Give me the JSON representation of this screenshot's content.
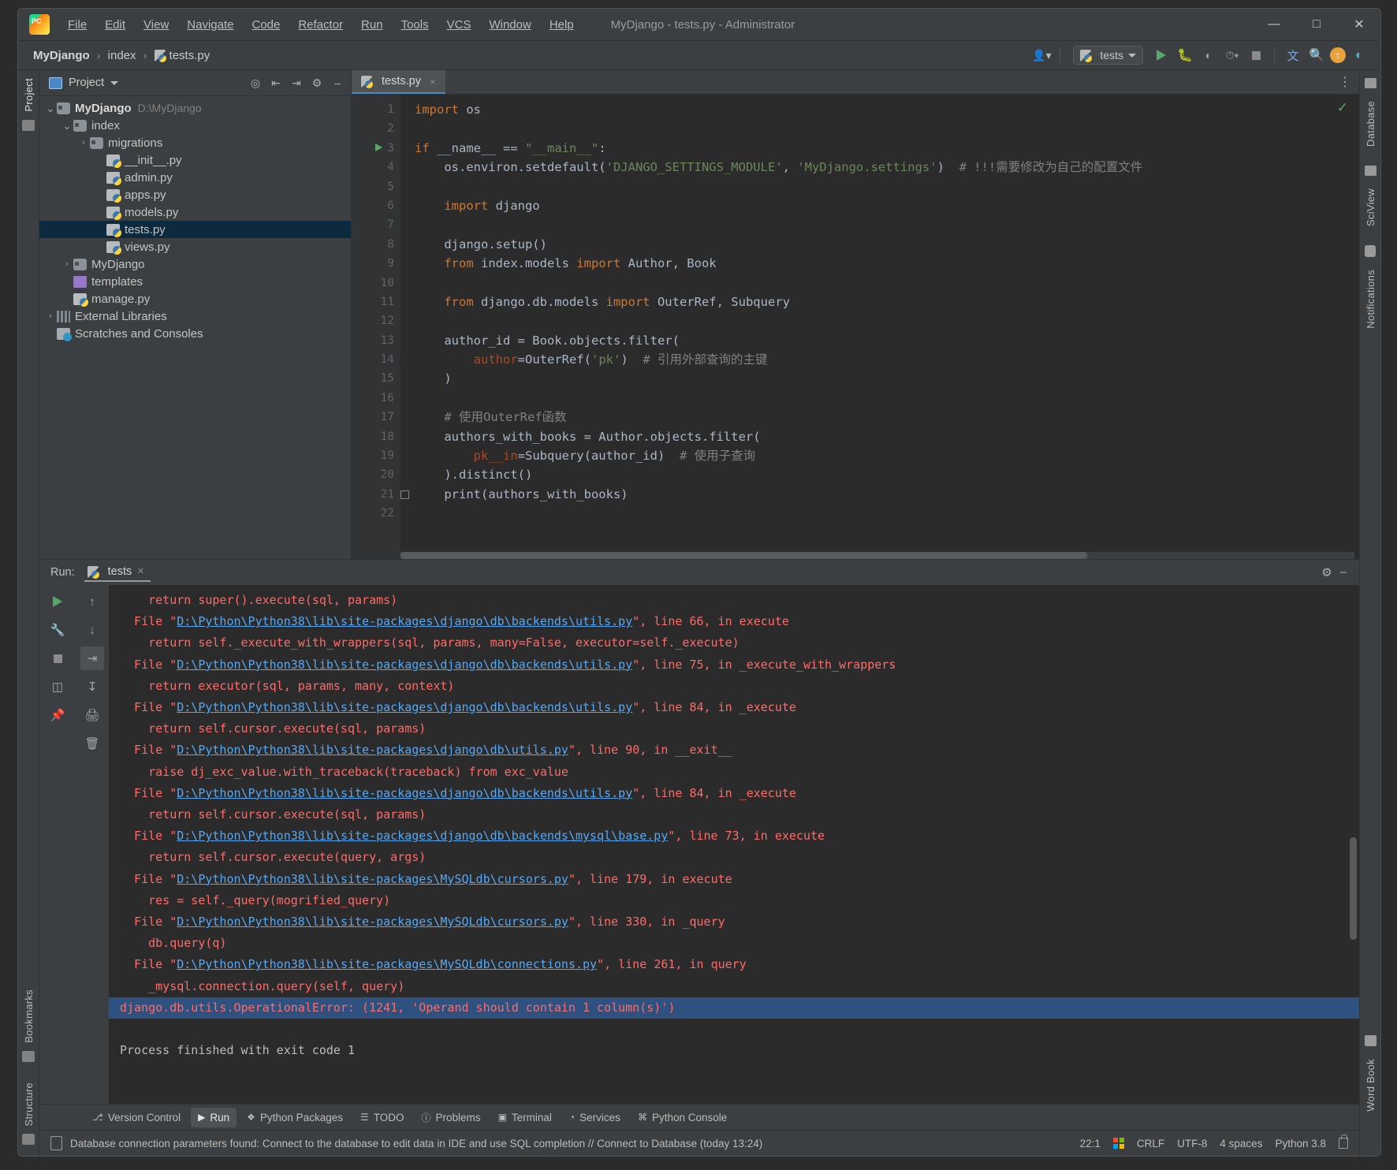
{
  "window": {
    "title": "MyDjango - tests.py - Administrator",
    "minimize": "—",
    "maximize": "□",
    "close": "✕"
  },
  "menu": [
    {
      "label": "File"
    },
    {
      "label": "Edit"
    },
    {
      "label": "View"
    },
    {
      "label": "Navigate"
    },
    {
      "label": "Code"
    },
    {
      "label": "Refactor"
    },
    {
      "label": "Run"
    },
    {
      "label": "Tools"
    },
    {
      "label": "VCS"
    },
    {
      "label": "Window"
    },
    {
      "label": "Help"
    }
  ],
  "breadcrumb": {
    "project": "MyDjango",
    "folder": "index",
    "file": "tests.py",
    "separator": "›"
  },
  "toolbar": {
    "run_config": "tests",
    "icons": [
      "profile-icon",
      "run-icon",
      "debug-icon",
      "coverage-icon",
      "profiler-icon",
      "stop-icon",
      "translate-icon",
      "search-icon",
      "update-icon",
      "ide-features-icon"
    ]
  },
  "project_panel": {
    "title": "Project",
    "tools": [
      "locate-icon",
      "expand-all-icon",
      "collapse-all-icon",
      "settings-icon",
      "hide-icon"
    ],
    "tree": [
      {
        "label": "MyDjango",
        "path": "D:\\MyDjango",
        "depth": 0,
        "arrow": "∨",
        "icon": "folder-root-icon",
        "bold": true,
        "selected": false
      },
      {
        "label": "index",
        "path": "",
        "depth": 1,
        "arrow": "∨",
        "icon": "folder-module-icon",
        "bold": false,
        "selected": false
      },
      {
        "label": "migrations",
        "path": "",
        "depth": 2,
        "arrow": "›",
        "icon": "folder-module-icon",
        "bold": false,
        "selected": false
      },
      {
        "label": "__init__.py",
        "path": "",
        "depth": 3,
        "arrow": "",
        "icon": "python-file-icon",
        "bold": false,
        "selected": false
      },
      {
        "label": "admin.py",
        "path": "",
        "depth": 3,
        "arrow": "",
        "icon": "python-file-icon",
        "bold": false,
        "selected": false
      },
      {
        "label": "apps.py",
        "path": "",
        "depth": 3,
        "arrow": "",
        "icon": "python-file-icon",
        "bold": false,
        "selected": false
      },
      {
        "label": "models.py",
        "path": "",
        "depth": 3,
        "arrow": "",
        "icon": "python-file-icon",
        "bold": false,
        "selected": false
      },
      {
        "label": "tests.py",
        "path": "",
        "depth": 3,
        "arrow": "",
        "icon": "python-file-icon",
        "bold": false,
        "selected": true
      },
      {
        "label": "views.py",
        "path": "",
        "depth": 3,
        "arrow": "",
        "icon": "python-file-icon",
        "bold": false,
        "selected": false
      },
      {
        "label": "MyDjango",
        "path": "",
        "depth": 1,
        "arrow": "›",
        "icon": "folder-module-icon",
        "bold": false,
        "selected": false
      },
      {
        "label": "templates",
        "path": "",
        "depth": 1,
        "arrow": "",
        "icon": "folder-templates-icon",
        "bold": false,
        "selected": false
      },
      {
        "label": "manage.py",
        "path": "",
        "depth": 1,
        "arrow": "",
        "icon": "python-file-icon",
        "bold": false,
        "selected": false
      },
      {
        "label": "External Libraries",
        "path": "",
        "depth": 0,
        "arrow": "›",
        "icon": "libraries-icon",
        "bold": false,
        "selected": false
      },
      {
        "label": "Scratches and Consoles",
        "path": "",
        "depth": 0,
        "arrow": "",
        "icon": "scratches-icon",
        "bold": false,
        "selected": false
      }
    ]
  },
  "editor": {
    "tab": {
      "label": "tests.py",
      "close": "×"
    },
    "inspection_status": "✓",
    "options_icon": "more-options-icon",
    "lines": [
      {
        "n": 1,
        "tokens": [
          {
            "t": "kw",
            "v": "import"
          },
          {
            "t": "p",
            "v": " os"
          }
        ],
        "indent": 0
      },
      {
        "n": 2,
        "tokens": [],
        "indent": 0
      },
      {
        "n": 3,
        "tokens": [
          {
            "t": "kw",
            "v": "if"
          },
          {
            "t": "p",
            "v": " __name__ == "
          },
          {
            "t": "str",
            "v": "\"__main__\""
          },
          {
            "t": "p",
            "v": ":"
          }
        ],
        "indent": 0,
        "gutter": "run"
      },
      {
        "n": 4,
        "tokens": [
          {
            "t": "p",
            "v": "os.environ.setdefault("
          },
          {
            "t": "str",
            "v": "'DJANGO_SETTINGS_MODULE'"
          },
          {
            "t": "p",
            "v": ", "
          },
          {
            "t": "str",
            "v": "'MyDjango.settings'"
          },
          {
            "t": "p",
            "v": ")  "
          },
          {
            "t": "cmt",
            "v": "# !!!需要修改为自己的配置文件"
          }
        ],
        "indent": 1
      },
      {
        "n": 5,
        "tokens": [],
        "indent": 0
      },
      {
        "n": 6,
        "tokens": [
          {
            "t": "kw",
            "v": "import"
          },
          {
            "t": "p",
            "v": " django"
          }
        ],
        "indent": 1
      },
      {
        "n": 7,
        "tokens": [],
        "indent": 0
      },
      {
        "n": 8,
        "tokens": [
          {
            "t": "p",
            "v": "django.setup()"
          }
        ],
        "indent": 1
      },
      {
        "n": 9,
        "tokens": [
          {
            "t": "kw",
            "v": "from"
          },
          {
            "t": "p",
            "v": " index.models "
          },
          {
            "t": "kw",
            "v": "import"
          },
          {
            "t": "p",
            "v": " Author, Book"
          }
        ],
        "indent": 1
      },
      {
        "n": 10,
        "tokens": [],
        "indent": 0
      },
      {
        "n": 11,
        "tokens": [
          {
            "t": "kw",
            "v": "from"
          },
          {
            "t": "p",
            "v": " django.db.models "
          },
          {
            "t": "kw",
            "v": "import"
          },
          {
            "t": "p",
            "v": " OuterRef, Subquery"
          }
        ],
        "indent": 1
      },
      {
        "n": 12,
        "tokens": [],
        "indent": 0
      },
      {
        "n": 13,
        "tokens": [
          {
            "t": "p",
            "v": "author_id = Book.objects.filter("
          }
        ],
        "indent": 1
      },
      {
        "n": 14,
        "tokens": [
          {
            "t": "param",
            "v": "author"
          },
          {
            "t": "p",
            "v": "=OuterRef("
          },
          {
            "t": "str",
            "v": "'pk'"
          },
          {
            "t": "p",
            "v": ")  "
          },
          {
            "t": "cmt",
            "v": "# 引用外部查询的主键"
          }
        ],
        "indent": 2
      },
      {
        "n": 15,
        "tokens": [
          {
            "t": "p",
            "v": ")"
          }
        ],
        "indent": 1
      },
      {
        "n": 16,
        "tokens": [],
        "indent": 0
      },
      {
        "n": 17,
        "tokens": [
          {
            "t": "cmt",
            "v": "# 使用OuterRef函数"
          }
        ],
        "indent": 1
      },
      {
        "n": 18,
        "tokens": [
          {
            "t": "p",
            "v": "authors_with_books = Author.objects.filter("
          }
        ],
        "indent": 1
      },
      {
        "n": 19,
        "tokens": [
          {
            "t": "param",
            "v": "pk__in"
          },
          {
            "t": "p",
            "v": "=Subquery(author_id)  "
          },
          {
            "t": "cmt",
            "v": "# 使用子查询"
          }
        ],
        "indent": 2
      },
      {
        "n": 20,
        "tokens": [
          {
            "t": "p",
            "v": ").distinct()"
          }
        ],
        "indent": 1
      },
      {
        "n": 21,
        "tokens": [
          {
            "t": "p",
            "v": "print(authors_with_books)"
          }
        ],
        "indent": 1,
        "gutter": "fold"
      },
      {
        "n": 22,
        "tokens": [],
        "indent": 0
      }
    ]
  },
  "run_panel": {
    "label": "Run:",
    "tab": "tests",
    "tab_close": "×",
    "head_icons": [
      "settings-icon",
      "hide-icon"
    ],
    "side_icons": [
      "rerun-icon",
      "up-arrow-icon",
      "down-arrow-icon",
      "settings-wrench-icon",
      "stop-icon",
      "soft-wrap-icon",
      "scroll-to-end-icon",
      "print-icon",
      "layout-icon",
      "pin-icon",
      "trash-icon"
    ],
    "console": [
      {
        "type": "plain-red",
        "text": "    return super().execute(sql, params)"
      },
      {
        "type": "file",
        "prefix": "  File \"",
        "link": "D:\\Python\\Python38\\lib\\site-packages\\django\\db\\backends\\utils.py",
        "suffix": "\", line 66, in execute"
      },
      {
        "type": "plain-red",
        "text": "    return self._execute_with_wrappers(sql, params, many=False, executor=self._execute)"
      },
      {
        "type": "file",
        "prefix": "  File \"",
        "link": "D:\\Python\\Python38\\lib\\site-packages\\django\\db\\backends\\utils.py",
        "suffix": "\", line 75, in _execute_with_wrappers"
      },
      {
        "type": "plain-red",
        "text": "    return executor(sql, params, many, context)"
      },
      {
        "type": "file",
        "prefix": "  File \"",
        "link": "D:\\Python\\Python38\\lib\\site-packages\\django\\db\\backends\\utils.py",
        "suffix": "\", line 84, in _execute"
      },
      {
        "type": "plain-red",
        "text": "    return self.cursor.execute(sql, params)"
      },
      {
        "type": "file",
        "prefix": "  File \"",
        "link": "D:\\Python\\Python38\\lib\\site-packages\\django\\db\\utils.py",
        "suffix": "\", line 90, in __exit__"
      },
      {
        "type": "plain-red",
        "text": "    raise dj_exc_value.with_traceback(traceback) from exc_value"
      },
      {
        "type": "file",
        "prefix": "  File \"",
        "link": "D:\\Python\\Python38\\lib\\site-packages\\django\\db\\backends\\utils.py",
        "suffix": "\", line 84, in _execute"
      },
      {
        "type": "plain-red",
        "text": "    return self.cursor.execute(sql, params)"
      },
      {
        "type": "file",
        "prefix": "  File \"",
        "link": "D:\\Python\\Python38\\lib\\site-packages\\django\\db\\backends\\mysql\\base.py",
        "suffix": "\", line 73, in execute"
      },
      {
        "type": "plain-red",
        "text": "    return self.cursor.execute(query, args)"
      },
      {
        "type": "file",
        "prefix": "  File \"",
        "link": "D:\\Python\\Python38\\lib\\site-packages\\MySQLdb\\cursors.py",
        "suffix": "\", line 179, in execute"
      },
      {
        "type": "plain-red",
        "text": "    res = self._query(mogrified_query)"
      },
      {
        "type": "file",
        "prefix": "  File \"",
        "link": "D:\\Python\\Python38\\lib\\site-packages\\MySQLdb\\cursors.py",
        "suffix": "\", line 330, in _query"
      },
      {
        "type": "plain-red",
        "text": "    db.query(q)"
      },
      {
        "type": "file",
        "prefix": "  File \"",
        "link": "D:\\Python\\Python38\\lib\\site-packages\\MySQLdb\\connections.py",
        "suffix": "\", line 261, in query"
      },
      {
        "type": "plain-red",
        "text": "    _mysql.connection.query(self, query)"
      },
      {
        "type": "error-selected",
        "text": "django.db.utils.OperationalError: (1241, 'Operand should contain 1 column(s)')"
      },
      {
        "type": "blank",
        "text": " "
      },
      {
        "type": "plain-grey",
        "text": "Process finished with exit code 1"
      }
    ]
  },
  "tool_buttons": [
    {
      "label": "Version Control",
      "icon": "branch-icon",
      "active": false
    },
    {
      "label": "Run",
      "icon": "run-icon",
      "active": true
    },
    {
      "label": "Python Packages",
      "icon": "packages-icon",
      "active": false
    },
    {
      "label": "TODO",
      "icon": "todo-icon",
      "active": false
    },
    {
      "label": "Problems",
      "icon": "problems-icon",
      "active": false
    },
    {
      "label": "Terminal",
      "icon": "terminal-icon",
      "active": false
    },
    {
      "label": "Services",
      "icon": "services-icon",
      "active": false
    },
    {
      "label": "Python Console",
      "icon": "python-console-icon",
      "active": false
    }
  ],
  "status_bar": {
    "message": "Database connection parameters found: Connect to the database to edit data in IDE and use SQL completion // Connect to Database (today 13:24)",
    "caret": "22:1",
    "line_sep": "CRLF",
    "encoding": "UTF-8",
    "indent": "4 spaces",
    "interpreter": "Python 3.8",
    "lock_icon": "lock-icon",
    "db_icon": "database-icon"
  },
  "side_strips": {
    "left": [
      "Project",
      "Bookmarks",
      "Structure"
    ],
    "right": [
      "Database",
      "SciView",
      "Notifications",
      "Word Book"
    ]
  },
  "colors": {
    "accent": "#4a88c7",
    "run_green": "#59a869",
    "error_red": "#ff6b68",
    "link_blue": "#56a8f5",
    "selection_blue": "#2f5180",
    "tree_selection": "#0d293e"
  }
}
